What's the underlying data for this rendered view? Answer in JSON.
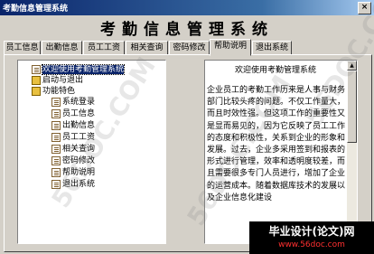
{
  "window": {
    "title": "考勤信息管理系统",
    "close": "×"
  },
  "heading": "考勤信息管理系统",
  "tabs": [
    "员工信息",
    "出勤信息",
    "员工工资",
    "相关查询",
    "密码修改",
    "帮助说明",
    "退出系统"
  ],
  "active_tab": "帮助说明",
  "tree": [
    {
      "label": "欢迎使用考勤管理系统",
      "icon": "document-icon",
      "selected": true
    },
    {
      "label": "启动与退出",
      "icon": "closed-book-icon"
    },
    {
      "label": "功能特色",
      "icon": "open-book-icon"
    },
    {
      "label": "系统登录",
      "icon": "document-icon"
    },
    {
      "label": "员工信息",
      "icon": "document-icon"
    },
    {
      "label": "出勤信息",
      "icon": "document-icon"
    },
    {
      "label": "员工工资",
      "icon": "document-icon"
    },
    {
      "label": "相关查询",
      "icon": "document-icon"
    },
    {
      "label": "密码修改",
      "icon": "document-icon"
    },
    {
      "label": "帮助说明",
      "icon": "document-icon"
    },
    {
      "label": "退出系统",
      "icon": "document-icon"
    }
  ],
  "help": {
    "title": "欢迎使用考勤管理系统",
    "body": "企业员工的考勤工作历来是人事与财务部门比较头疼的问题。不仅工作量大，而且时效性强。但这项工作的重要性又是显而易见的，因为它反映了员工工作的态度和积极性，关系到企业的形象和发展。过去，企业多采用签到和报表的形式进行管理，效率和透明度较差，而且需要很多专门人员进行，增加了企业的运营成本。随着数据库技术的发展以及企业信息化建设"
  },
  "watermark": "56DOC.COM",
  "banner": {
    "line1": "毕业设计(论文)网",
    "line2": "www.56doc.com"
  }
}
